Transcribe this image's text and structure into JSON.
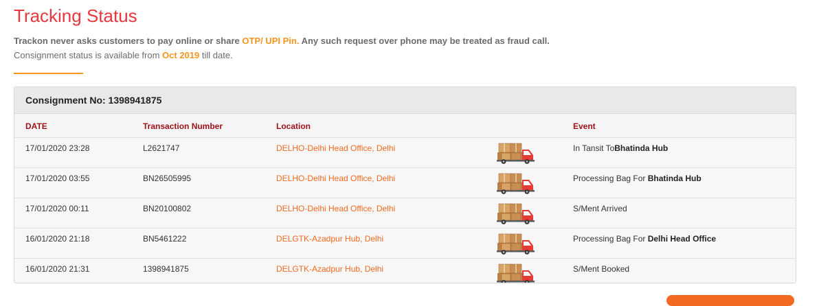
{
  "page": {
    "title": "Tracking Status",
    "warning_prefix": "Trackon never asks customers to pay online or share ",
    "warning_highlight": "OTP/ UPI Pin.",
    "warning_suffix": " Any such request over phone may be treated as fraud call.",
    "availability_prefix": "Consignment status is available from ",
    "availability_highlight": "Oct 2019",
    "availability_suffix": " till date."
  },
  "colors": {
    "title": "#e8373e",
    "accent": "#f7941d",
    "table_header_text": "#a0121a",
    "location_link": "#f26a21"
  },
  "consignment": {
    "label": "Consignment No: 1398941875"
  },
  "table": {
    "headers": {
      "date": "DATE",
      "transaction": "Transaction Number",
      "location": "Location",
      "event": "Event"
    },
    "rows": [
      {
        "date": "17/01/2020 23:28",
        "transaction": "L2621747",
        "location": "DELHO-Delhi Head Office, Delhi",
        "icon": "delivery-truck-icon",
        "event_prefix": "In Tansit To",
        "event_bold": "Bhatinda Hub"
      },
      {
        "date": "17/01/2020 03:55",
        "transaction": "BN26505995",
        "location": "DELHO-Delhi Head Office, Delhi",
        "icon": "delivery-truck-icon",
        "event_prefix": "Processing Bag For ",
        "event_bold": "Bhatinda Hub"
      },
      {
        "date": "17/01/2020 00:11",
        "transaction": "BN20100802",
        "location": "DELHO-Delhi Head Office, Delhi",
        "icon": "delivery-truck-icon",
        "event_prefix": "S/Ment Arrived",
        "event_bold": ""
      },
      {
        "date": "16/01/2020 21:18",
        "transaction": "BN5461222",
        "location": "DELGTK-Azadpur Hub, Delhi",
        "icon": "delivery-truck-icon",
        "event_prefix": "Processing Bag For ",
        "event_bold": "Delhi Head Office"
      },
      {
        "date": "16/01/2020 21:31",
        "transaction": "1398941875",
        "location": "DELGTK-Azadpur Hub, Delhi",
        "icon": "delivery-truck-icon",
        "event_prefix": "S/Ment Booked",
        "event_bold": ""
      }
    ]
  }
}
